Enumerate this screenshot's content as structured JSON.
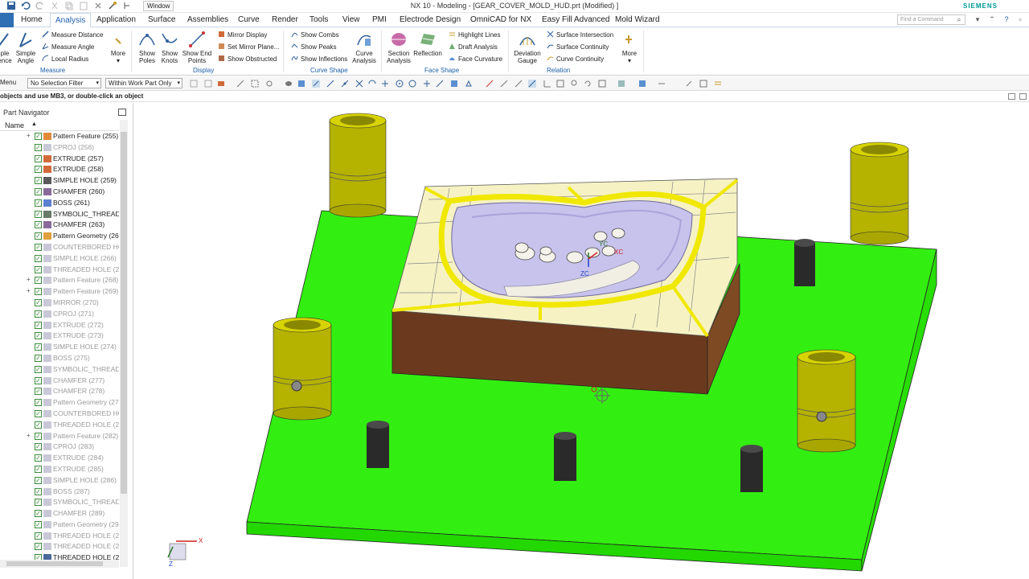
{
  "window": {
    "menu_label": "Window",
    "title": "NX 10 - Modeling - [GEAR_COVER_MOLD_HUD.prt  (Modified) ]",
    "brand": "SIEMENS",
    "find_placeholder": "Find a Command"
  },
  "menu_tabs": [
    "Home",
    "Analysis",
    "Application",
    "Surface",
    "Assemblies",
    "Curve",
    "Render",
    "Tools",
    "View",
    "PMI",
    "Electrode Design",
    "OmniCAD for NX",
    "Easy Fill Advanced",
    "Mold Wizard"
  ],
  "active_tab": "Analysis",
  "ribbon": {
    "measure": {
      "big_left": [
        "ple",
        "ence"
      ],
      "simple_angle": [
        "Simple",
        "Angle"
      ],
      "items": [
        "Measure Distance",
        "Measure Angle",
        "Local Radius"
      ],
      "more": "More",
      "label": "Measure"
    },
    "display": {
      "show_poles": [
        "Show",
        "Poles"
      ],
      "show_knots": [
        "Show",
        "Knots"
      ],
      "show_end_points": [
        "Show End",
        "Points"
      ],
      "items": [
        "Mirror Display",
        "Set Mirror Plane...",
        "Show Obstructed"
      ],
      "label": "Display"
    },
    "curve_shape": {
      "items": [
        "Show Combs",
        "Show Peaks",
        "Show Inflections"
      ],
      "curve_analysis": [
        "Curve",
        "Analysis"
      ],
      "label": "Curve Shape"
    },
    "face_shape": {
      "section_analysis": [
        "Section",
        "Analysis"
      ],
      "reflection": "Reflection",
      "items": [
        "Highlight Lines",
        "Draft Analysis",
        "Face Curvature"
      ],
      "label": "Face Shape"
    },
    "relation": {
      "deviation_gauge": [
        "Deviation",
        "Gauge"
      ],
      "items": [
        "Surface Intersection",
        "Surface Continuity",
        "Curve Continuity"
      ],
      "more": "More",
      "label": "Relation"
    }
  },
  "selection_bar": {
    "menu": "Menu",
    "filter": "No Selection Filter",
    "scope": "Within Work Part Only"
  },
  "cue_line": "objects and use MB3, or double-click an object",
  "navigator": {
    "title": "Part Navigator",
    "column": "Name",
    "rows": [
      {
        "label": "Pattern Feature (255)",
        "icon": "pattern-icon",
        "expand": true,
        "dim": false
      },
      {
        "label": "CPROJ (256)",
        "icon": "curve-icon",
        "expand": false,
        "dim": true
      },
      {
        "label": "EXTRUDE (257)",
        "icon": "extrude-icon",
        "expand": false,
        "dim": false
      },
      {
        "label": "EXTRUDE (258)",
        "icon": "extrude-icon",
        "expand": false,
        "dim": false
      },
      {
        "label": "SIMPLE HOLE (259)",
        "icon": "hole-icon",
        "expand": false,
        "dim": false
      },
      {
        "label": "CHAMFER (260)",
        "icon": "chamfer-icon",
        "expand": false,
        "dim": false
      },
      {
        "label": "BOSS (261)",
        "icon": "boss-icon",
        "expand": false,
        "dim": false
      },
      {
        "label": "SYMBOLIC_THREAD (2",
        "icon": "thread-icon",
        "expand": false,
        "dim": false
      },
      {
        "label": "CHAMFER (263)",
        "icon": "chamfer-icon",
        "expand": false,
        "dim": false
      },
      {
        "label": "Pattern Geometry (26",
        "icon": "pattern-geom-icon",
        "expand": false,
        "dim": false
      },
      {
        "label": "COUNTERBORED HOL",
        "icon": "counterbore-icon",
        "expand": false,
        "dim": true
      },
      {
        "label": "SIMPLE HOLE (266)",
        "icon": "hole-icon",
        "expand": false,
        "dim": true
      },
      {
        "label": "THREADED HOLE (26",
        "icon": "threaded-hole-icon",
        "expand": false,
        "dim": true
      },
      {
        "label": "Pattern Feature (268)",
        "icon": "pattern-icon",
        "expand": true,
        "dim": true
      },
      {
        "label": "Pattern Feature (269)",
        "icon": "pattern-icon",
        "expand": true,
        "dim": true
      },
      {
        "label": "MIRROR (270)",
        "icon": "mirror-icon",
        "expand": false,
        "dim": true
      },
      {
        "label": "CPROJ (271)",
        "icon": "curve-icon",
        "expand": false,
        "dim": true
      },
      {
        "label": "EXTRUDE (272)",
        "icon": "extrude-icon",
        "expand": false,
        "dim": true
      },
      {
        "label": "EXTRUDE (273)",
        "icon": "extrude-icon",
        "expand": false,
        "dim": true
      },
      {
        "label": "SIMPLE HOLE (274)",
        "icon": "hole-icon",
        "expand": false,
        "dim": true
      },
      {
        "label": "BOSS (275)",
        "icon": "boss-icon",
        "expand": false,
        "dim": true
      },
      {
        "label": "SYMBOLIC_THREAD (",
        "icon": "thread-icon",
        "expand": false,
        "dim": true
      },
      {
        "label": "CHAMFER (277)",
        "icon": "chamfer-icon",
        "expand": false,
        "dim": true
      },
      {
        "label": "CHAMFER (278)",
        "icon": "chamfer-icon",
        "expand": false,
        "dim": true
      },
      {
        "label": "Pattern Geometry (27",
        "icon": "pattern-geom-icon",
        "expand": false,
        "dim": true
      },
      {
        "label": "COUNTERBORED HOL",
        "icon": "counterbore-icon",
        "expand": false,
        "dim": true
      },
      {
        "label": "THREADED HOLE (28",
        "icon": "threaded-hole-icon",
        "expand": false,
        "dim": true
      },
      {
        "label": "Pattern Feature (282)",
        "icon": "pattern-icon",
        "expand": true,
        "dim": true
      },
      {
        "label": "CPROJ (283)",
        "icon": "curve-icon",
        "expand": false,
        "dim": true
      },
      {
        "label": "EXTRUDE (284)",
        "icon": "extrude-icon",
        "expand": false,
        "dim": true
      },
      {
        "label": "EXTRUDE (285)",
        "icon": "extrude-icon",
        "expand": false,
        "dim": true
      },
      {
        "label": "SIMPLE HOLE (286)",
        "icon": "hole-icon",
        "expand": false,
        "dim": true
      },
      {
        "label": "BOSS (287)",
        "icon": "boss-icon",
        "expand": false,
        "dim": true
      },
      {
        "label": "SYMBOLIC_THREAD (",
        "icon": "thread-icon",
        "expand": false,
        "dim": true
      },
      {
        "label": "CHAMFER (289)",
        "icon": "chamfer-icon",
        "expand": false,
        "dim": true
      },
      {
        "label": "Pattern Geometry (29",
        "icon": "pattern-geom-icon",
        "expand": false,
        "dim": true
      },
      {
        "label": "THREADED HOLE (29",
        "icon": "threaded-hole-icon",
        "expand": false,
        "dim": true
      },
      {
        "label": "THREADED HOLE (29",
        "icon": "threaded-hole-icon",
        "expand": false,
        "dim": true
      },
      {
        "label": "THREADED HOLE (29",
        "icon": "threaded-hole-icon",
        "expand": false,
        "dim": false
      }
    ]
  },
  "viewport": {
    "wcs_labels": {
      "x": "XC",
      "y": "YC",
      "z": "ZC"
    },
    "triad_labels": {
      "x": "X",
      "z": "Z"
    }
  },
  "colors": {
    "accent": "#1d5fa8",
    "plate": "#33ee11",
    "block": "#6b3a1e",
    "guide_bushing": "#b5b200",
    "pin": "#2a2a2a",
    "cavity": "#c7c3ec",
    "parting_face": "#f6f2c4"
  }
}
